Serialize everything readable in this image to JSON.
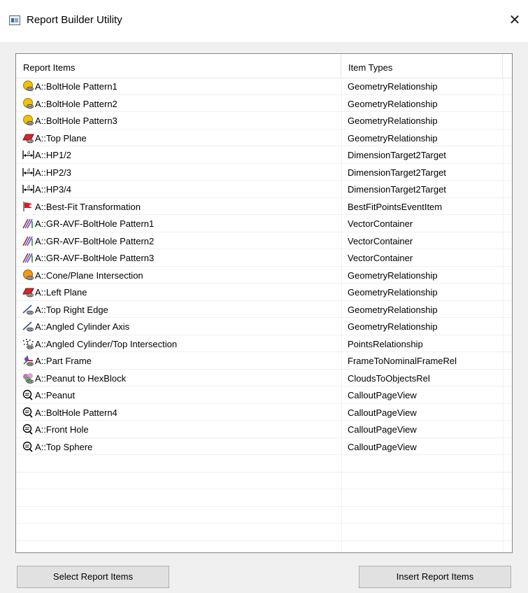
{
  "window": {
    "title": "Report Builder Utility",
    "close_glyph": "✕",
    "app_icon": "window-app-icon"
  },
  "table": {
    "headers": [
      "Report Items",
      "Item Types"
    ],
    "rows": [
      {
        "name": "A::BoltHole Pattern1",
        "type": "GeometryRelationship",
        "icon": "circle-relationship-icon"
      },
      {
        "name": "A::BoltHole Pattern2",
        "type": "GeometryRelationship",
        "icon": "circle-relationship-icon"
      },
      {
        "name": "A::BoltHole Pattern3",
        "type": "GeometryRelationship",
        "icon": "circle-relationship-icon"
      },
      {
        "name": "A::Top Plane",
        "type": "GeometryRelationship",
        "icon": "plane-relationship-icon"
      },
      {
        "name": "A::HP1/2",
        "type": "DimensionTarget2Target",
        "icon": "dimension-icon"
      },
      {
        "name": "A::HP2/3",
        "type": "DimensionTarget2Target",
        "icon": "dimension-icon"
      },
      {
        "name": "A::HP3/4",
        "type": "DimensionTarget2Target",
        "icon": "dimension-icon"
      },
      {
        "name": "A::Best-Fit Transformation",
        "type": "BestFitPointsEventItem",
        "icon": "flag-icon"
      },
      {
        "name": "A::GR-AVF-BoltHole Pattern1",
        "type": "VectorContainer",
        "icon": "vector-icon"
      },
      {
        "name": "A::GR-AVF-BoltHole Pattern2",
        "type": "VectorContainer",
        "icon": "vector-icon"
      },
      {
        "name": "A::GR-AVF-BoltHole Pattern3",
        "type": "VectorContainer",
        "icon": "vector-icon"
      },
      {
        "name": "A::Cone/Plane Intersection",
        "type": "GeometryRelationship",
        "icon": "cone-relationship-icon"
      },
      {
        "name": "A::Left Plane",
        "type": "GeometryRelationship",
        "icon": "plane-relationship-icon"
      },
      {
        "name": "A::Top Right Edge",
        "type": "GeometryRelationship",
        "icon": "line-relationship-icon"
      },
      {
        "name": "A::Angled Cylinder Axis",
        "type": "GeometryRelationship",
        "icon": "line-relationship-icon"
      },
      {
        "name": "A::Angled Cylinder/Top Intersection",
        "type": "PointsRelationship",
        "icon": "points-relationship-icon"
      },
      {
        "name": "A::Part Frame",
        "type": "FrameToNominalFrameRel",
        "icon": "frame-icon"
      },
      {
        "name": "A::Peanut to HexBlock",
        "type": "CloudsToObjectsRel",
        "icon": "cloud-icon"
      },
      {
        "name": "A::Peanut",
        "type": "CalloutPageView",
        "icon": "callout-icon"
      },
      {
        "name": "A::BoltHole Pattern4",
        "type": "CalloutPageView",
        "icon": "callout-icon"
      },
      {
        "name": "A::Front Hole",
        "type": "CalloutPageView",
        "icon": "callout-icon"
      },
      {
        "name": "A::Top Sphere",
        "type": "CalloutPageView",
        "icon": "callout-icon"
      }
    ],
    "empty_rows": 6
  },
  "buttons": {
    "select_label": "Select Report Items",
    "insert_label": "Insert Report Items"
  }
}
